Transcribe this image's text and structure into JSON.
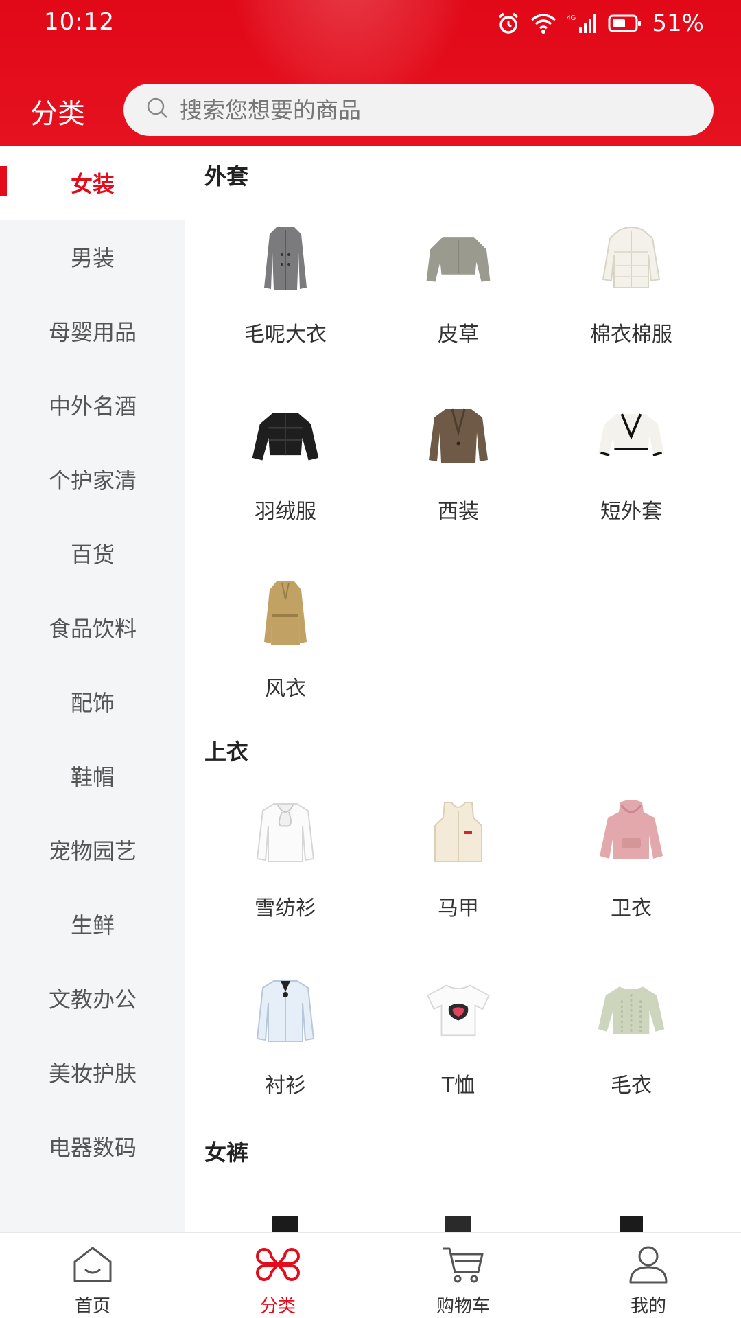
{
  "status_bar": {
    "time": "10:12",
    "battery": "51%"
  },
  "header": {
    "title": "分类",
    "search_placeholder": "搜索您想要的商品"
  },
  "sidebar": {
    "items": [
      {
        "label": "女装",
        "active": true
      },
      {
        "label": "男装"
      },
      {
        "label": "母婴用品"
      },
      {
        "label": "中外名酒"
      },
      {
        "label": "个护家清"
      },
      {
        "label": "百货"
      },
      {
        "label": "食品饮料"
      },
      {
        "label": "配饰"
      },
      {
        "label": "鞋帽"
      },
      {
        "label": "宠物园艺"
      },
      {
        "label": "生鲜"
      },
      {
        "label": "文教办公"
      },
      {
        "label": "美妆护肤"
      },
      {
        "label": "电器数码"
      }
    ]
  },
  "content": {
    "sections": [
      {
        "title": "外套",
        "items": [
          {
            "label": "毛呢大衣",
            "icon": "wool-coat-icon"
          },
          {
            "label": "皮草",
            "icon": "fur-jacket-icon"
          },
          {
            "label": "棉衣棉服",
            "icon": "cotton-coat-icon"
          },
          {
            "label": "羽绒服",
            "icon": "down-jacket-icon"
          },
          {
            "label": "西装",
            "icon": "blazer-icon"
          },
          {
            "label": "短外套",
            "icon": "short-jacket-icon"
          },
          {
            "label": "风衣",
            "icon": "trench-coat-icon"
          }
        ]
      },
      {
        "title": "上衣",
        "items": [
          {
            "label": "雪纺衫",
            "icon": "chiffon-blouse-icon"
          },
          {
            "label": "马甲",
            "icon": "vest-icon"
          },
          {
            "label": "卫衣",
            "icon": "hoodie-icon"
          },
          {
            "label": "衬衫",
            "icon": "shirt-icon"
          },
          {
            "label": "T恤",
            "icon": "tshirt-icon"
          },
          {
            "label": "毛衣",
            "icon": "sweater-icon"
          }
        ]
      },
      {
        "title": "女裤",
        "items": [
          {
            "label": "",
            "icon": "pants-icon"
          },
          {
            "label": "",
            "icon": "pants-icon"
          },
          {
            "label": "",
            "icon": "pants-icon"
          }
        ]
      }
    ]
  },
  "bottom_nav": {
    "items": [
      {
        "label": "首页",
        "icon": "home-icon"
      },
      {
        "label": "分类",
        "icon": "category-icon",
        "active": true
      },
      {
        "label": "购物车",
        "icon": "cart-icon"
      },
      {
        "label": "我的",
        "icon": "profile-icon"
      }
    ]
  },
  "colors": {
    "brand_red": "#e50b1a",
    "sidebar_bg": "#f4f5f7"
  }
}
